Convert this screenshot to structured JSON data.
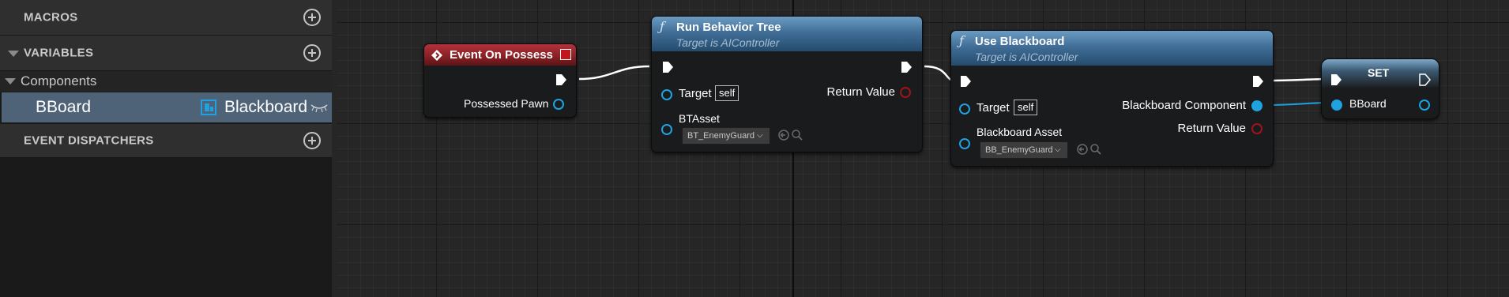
{
  "panel": {
    "macros": {
      "label": "MACROS"
    },
    "variables": {
      "label": "VARIABLES"
    },
    "components": {
      "label": "Components"
    },
    "variable_row": {
      "name": "BBoard",
      "type": "Blackboard"
    },
    "event_dispatchers": {
      "label": "EVENT DISPATCHERS"
    }
  },
  "nodes": {
    "event_on_possess": {
      "title": "Event On Possess",
      "out_pin": "Possessed Pawn"
    },
    "run_behavior_tree": {
      "title": "Run Behavior Tree",
      "subtitle": "Target is AIController",
      "target_label": "Target",
      "target_value": "self",
      "return_label": "Return Value",
      "asset_label": "BTAsset",
      "asset_value": "BT_EnemyGuard"
    },
    "use_blackboard": {
      "title": "Use Blackboard",
      "subtitle": "Target is AIController",
      "target_label": "Target",
      "target_value": "self",
      "component_label": "Blackboard Component",
      "return_label": "Return Value",
      "asset_label": "Blackboard Asset",
      "asset_value": "BB_EnemyGuard"
    },
    "set": {
      "title": "SET",
      "var_label": "BBoard"
    }
  },
  "colors": {
    "exec_pin": "#ffffff",
    "object_pin": "#1fa2e0",
    "bool_pin": "#a1131b",
    "event_header": "#8a2126",
    "function_header": "#416e97",
    "selected_row": "#4e6378"
  },
  "icons": {
    "add": "plus-circle-icon",
    "collapse": "triangle-down-icon",
    "blackboard": "blackboard-icon",
    "visibility": "eye-closed-icon",
    "event": "event-diamond-icon",
    "function": "function-f-icon",
    "browse": "browse-arrow-icon",
    "search": "search-icon"
  }
}
